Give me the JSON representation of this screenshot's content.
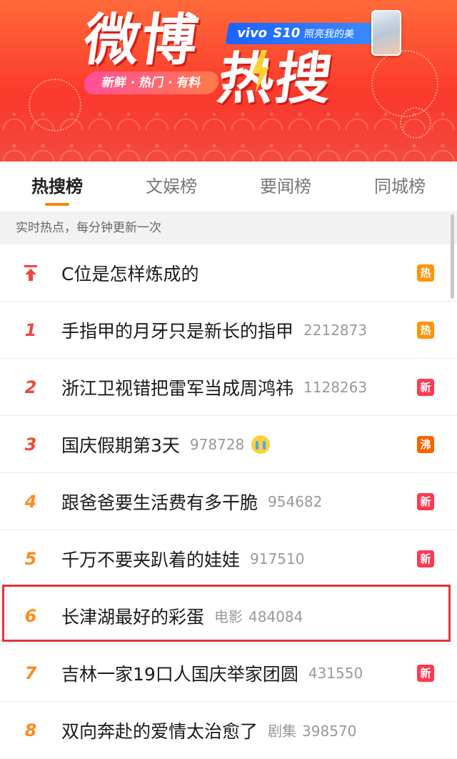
{
  "banner": {
    "title_weibo": "微博",
    "title_resou": "热搜",
    "ad_brand": "vivo",
    "ad_model": "S10",
    "ad_slogan": "照亮我的美",
    "tagline": "新鲜 · 热门 · 有料"
  },
  "tabs": [
    {
      "label": "热搜榜",
      "active": true
    },
    {
      "label": "文娱榜",
      "active": false
    },
    {
      "label": "要闻榜",
      "active": false
    },
    {
      "label": "同城榜",
      "active": false
    }
  ],
  "subtitle": "实时热点，每分钟更新一次",
  "list": {
    "pinned": {
      "icon": "pin-top-icon",
      "topic": "C位是怎样炼成的",
      "badge": "热"
    },
    "items": [
      {
        "rank": "1",
        "topic": "手指甲的月牙只是新长的指甲",
        "category": "",
        "count": "2212873",
        "badge": "热"
      },
      {
        "rank": "2",
        "topic": "浙江卫视错把雷军当成周鸿祎",
        "category": "",
        "count": "1128263",
        "badge": "新"
      },
      {
        "rank": "3",
        "topic": "国庆假期第3天",
        "category": "",
        "count": "978728",
        "badge": "沸",
        "emoji": "crying-face-icon"
      },
      {
        "rank": "4",
        "topic": "跟爸爸要生活费有多干脆",
        "category": "",
        "count": "954682",
        "badge": "新"
      },
      {
        "rank": "5",
        "topic": "千万不要夹趴着的娃娃",
        "category": "",
        "count": "917510",
        "badge": "新"
      },
      {
        "rank": "6",
        "topic": "长津湖最好的彩蛋",
        "category": "电影",
        "count": "484084",
        "badge": ""
      },
      {
        "rank": "7",
        "topic": "吉林一家19口人国庆举家团圆",
        "category": "",
        "count": "431550",
        "badge": "新"
      },
      {
        "rank": "8",
        "topic": "双向奔赴的爱情太治愈了",
        "category": "剧集",
        "count": "398570",
        "badge": ""
      }
    ]
  },
  "colors": {
    "accent": "#ff8200",
    "banner_red": "#fb3c2c",
    "rank_top": "#f0483a",
    "rank_other": "#ff8a1e",
    "badge_hot": "#ff9406",
    "badge_new": "#ff3852",
    "badge_boil": "#f86400",
    "highlight": "#e8323c"
  }
}
